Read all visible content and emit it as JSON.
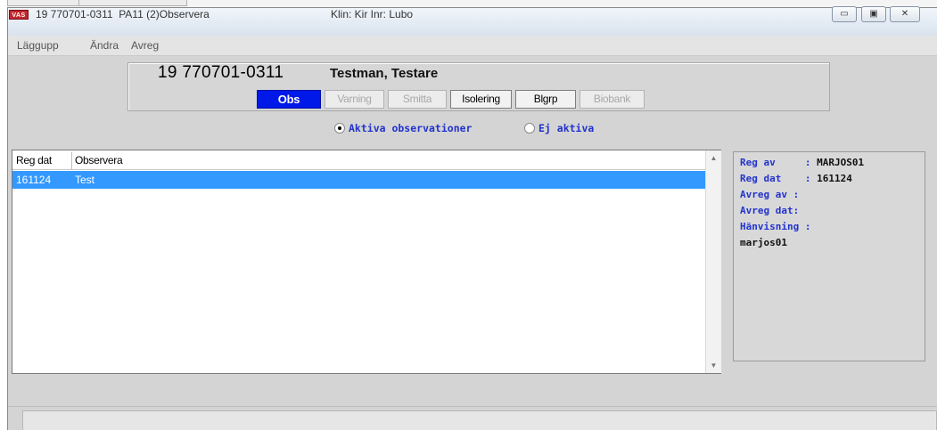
{
  "window": {
    "app_icon_text": "VAS",
    "title_left": "19 770701-0311  PA11 (2)Observera",
    "title_mid": "Klin: Kir Inr: Lubo",
    "buttons": {
      "minimize": "▭",
      "maximize": "▣",
      "close": "✕"
    }
  },
  "menu": {
    "items": [
      "Läggupp",
      "Ändra",
      "Avreg"
    ]
  },
  "patient": {
    "id": "19 770701-0311",
    "name": "Testman, Testare"
  },
  "tabs": [
    {
      "label": "Obs",
      "state": "active"
    },
    {
      "label": "Varning",
      "state": "disabled"
    },
    {
      "label": "Smitta",
      "state": "disabled"
    },
    {
      "label": "Isolering",
      "state": "enabled"
    },
    {
      "label": "Blgrp",
      "state": "enabled"
    },
    {
      "label": "Biobank",
      "state": "disabled"
    }
  ],
  "filter": {
    "options": [
      {
        "label": "Aktiva observationer",
        "selected": true
      },
      {
        "label": "Ej aktiva",
        "selected": false
      }
    ]
  },
  "list": {
    "columns": [
      "Reg dat",
      "Observera"
    ],
    "rows": [
      {
        "reg_dat": "161124",
        "observera": "Test",
        "selected": true
      }
    ],
    "scroll_up": "▲",
    "scroll_down": "▼"
  },
  "details": {
    "lines": [
      {
        "label": "Reg av     : ",
        "value": "MARJOS01"
      },
      {
        "label": "Reg dat    : ",
        "value": "161124"
      },
      {
        "label": "Avreg av : ",
        "value": ""
      },
      {
        "label": "Avreg dat:",
        "value": ""
      },
      {
        "label": "Hänvisning :",
        "value": ""
      },
      {
        "label": "",
        "value": "marjos01"
      }
    ]
  },
  "colors": {
    "active_tab": "#0018e8",
    "selection": "#3399ff",
    "detail_label": "#2233cc"
  }
}
